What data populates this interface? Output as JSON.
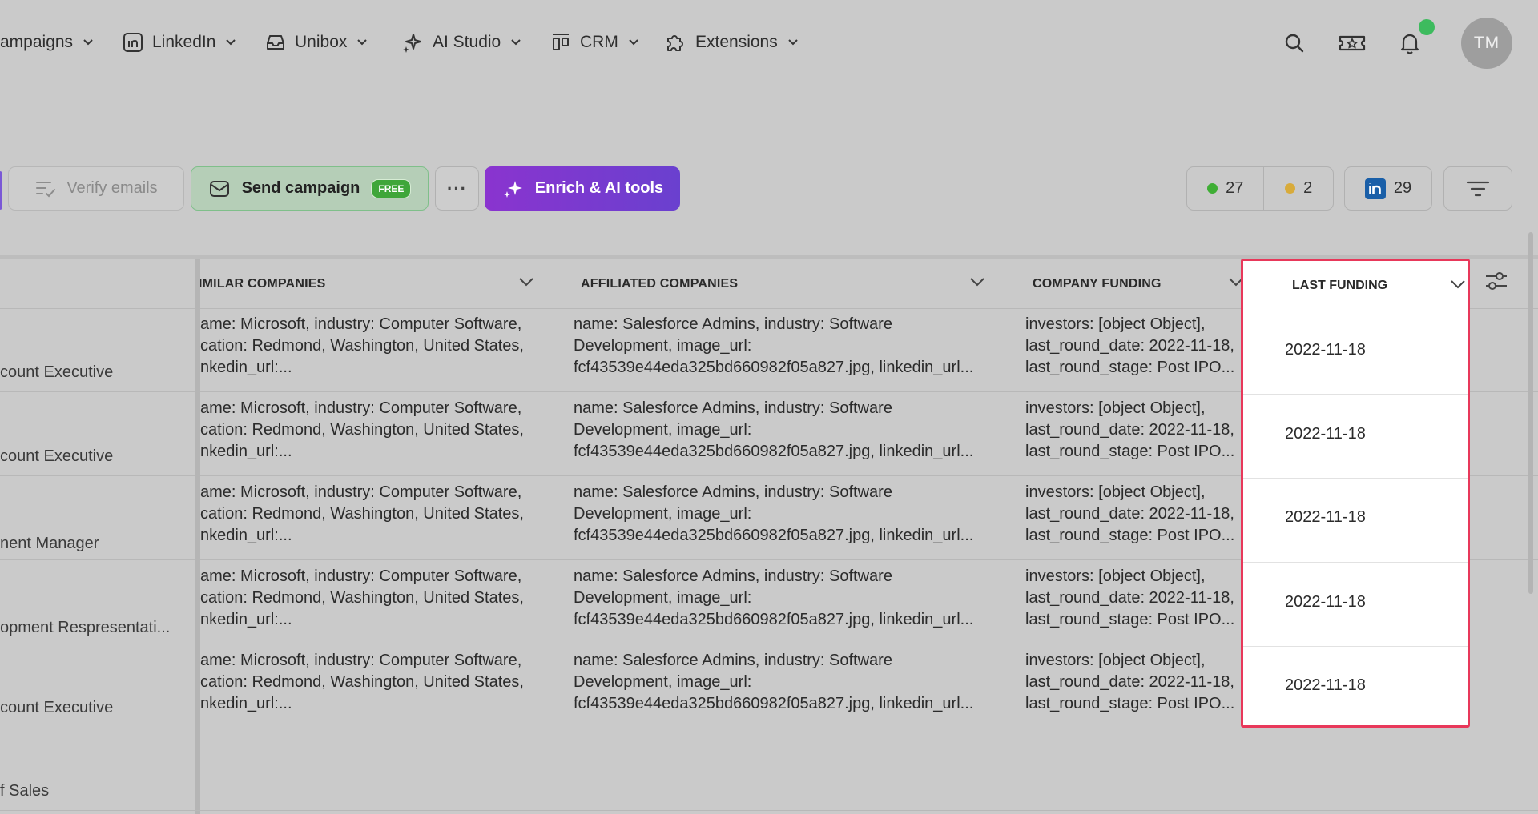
{
  "nav": {
    "items": [
      {
        "label": "ampaigns",
        "icon": "campaigns-icon"
      },
      {
        "label": "LinkedIn",
        "icon": "linkedin-icon"
      },
      {
        "label": "Unibox",
        "icon": "inbox-icon"
      },
      {
        "label": "AI Studio",
        "icon": "sparkle-icon"
      },
      {
        "label": "CRM",
        "icon": "crm-icon"
      },
      {
        "label": "Extensions",
        "icon": "puzzle-icon"
      }
    ],
    "avatar_initials": "TM",
    "notification_dot_color": "#3dbb5e"
  },
  "toolbar": {
    "verify_label": "Verify emails",
    "send_label": "Send campaign",
    "free_badge": "FREE",
    "more_label": "···",
    "enrich_label": "Enrich & AI tools",
    "stats": {
      "green_count": "27",
      "yellow_count": "2",
      "linkedin_count": "29"
    },
    "colors": {
      "green_dot": "#3fae35",
      "yellow_dot": "#d8ab3b",
      "enrich_gradient_start": "#8a34cf",
      "enrich_gradient_end": "#6a40cf"
    }
  },
  "table": {
    "columns": [
      "IMILAR COMPANIES",
      "AFFILIATED COMPANIES",
      "COMPANY FUNDING",
      "LAST FUNDING"
    ],
    "left_column_values": [
      "count Executive",
      "count Executive",
      "nent Manager",
      "opment Respresentati...",
      "count Executive",
      "f Sales"
    ],
    "rows": [
      {
        "similar": [
          "ame: Microsoft, industry: Computer Software,",
          "cation: Redmond, Washington, United States,",
          "nkedin_url:..."
        ],
        "affiliated": [
          "name: Salesforce Admins, industry: Software",
          "Development, image_url:",
          "fcf43539e44eda325bd660982f05a827.jpg, linkedin_url..."
        ],
        "funding": [
          "investors: [object Object],",
          "last_round_date: 2022-11-18,",
          "last_round_stage: Post IPO..."
        ],
        "last_funding": "2022-11-18"
      },
      {
        "similar": [
          "ame: Microsoft, industry: Computer Software,",
          "cation: Redmond, Washington, United States,",
          "nkedin_url:..."
        ],
        "affiliated": [
          "name: Salesforce Admins, industry: Software",
          "Development, image_url:",
          "fcf43539e44eda325bd660982f05a827.jpg, linkedin_url..."
        ],
        "funding": [
          "investors: [object Object],",
          "last_round_date: 2022-11-18,",
          "last_round_stage: Post IPO..."
        ],
        "last_funding": "2022-11-18"
      },
      {
        "similar": [
          "ame: Microsoft, industry: Computer Software,",
          "cation: Redmond, Washington, United States,",
          "nkedin_url:..."
        ],
        "affiliated": [
          "name: Salesforce Admins, industry: Software",
          "Development, image_url:",
          "fcf43539e44eda325bd660982f05a827.jpg, linkedin_url..."
        ],
        "funding": [
          "investors: [object Object],",
          "last_round_date: 2022-11-18,",
          "last_round_stage: Post IPO..."
        ],
        "last_funding": "2022-11-18"
      },
      {
        "similar": [
          "ame: Microsoft, industry: Computer Software,",
          "cation: Redmond, Washington, United States,",
          "nkedin_url:..."
        ],
        "affiliated": [
          "name: Salesforce Admins, industry: Software",
          "Development, image_url:",
          "fcf43539e44eda325bd660982f05a827.jpg, linkedin_url..."
        ],
        "funding": [
          "investors: [object Object],",
          "last_round_date: 2022-11-18,",
          "last_round_stage: Post IPO..."
        ],
        "last_funding": "2022-11-18"
      },
      {
        "similar": [
          "ame: Microsoft, industry: Computer Software,",
          "cation: Redmond, Washington, United States,",
          "nkedin_url:..."
        ],
        "affiliated": [
          "name: Salesforce Admins, industry: Software",
          "Development, image_url:",
          "fcf43539e44eda325bd660982f05a827.jpg, linkedin_url..."
        ],
        "funding": [
          "investors: [object Object],",
          "last_round_date: 2022-11-18,",
          "last_round_stage: Post IPO..."
        ],
        "last_funding": "2022-11-18"
      }
    ],
    "highlight_color": "#e8385a"
  }
}
